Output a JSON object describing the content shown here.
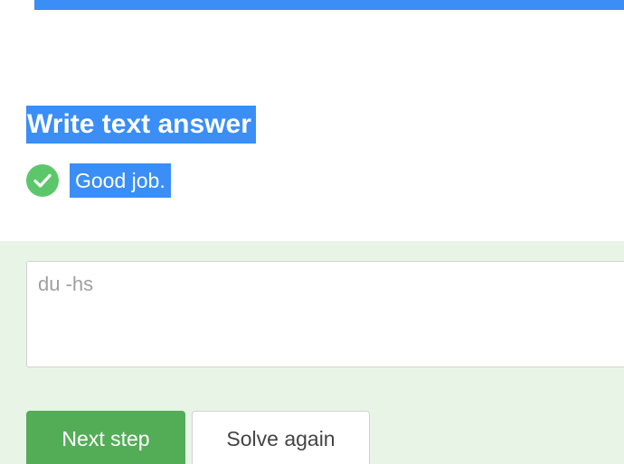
{
  "top_strip": {
    "text": "... , ... ... ..., ... ... ... ... ..."
  },
  "step": {
    "heading": "Write text answer",
    "feedback_icon": "check-circle-icon",
    "feedback_text": "Good job."
  },
  "answer": {
    "placeholder": "du -hs",
    "value": ""
  },
  "buttons": {
    "next_label": "Next step",
    "solve_again_label": "Solve again"
  },
  "colors": {
    "selection": "#3a8ef6",
    "success": "#5cc76a",
    "primary_button": "#53ad57",
    "answer_background": "#e8f5e6"
  }
}
